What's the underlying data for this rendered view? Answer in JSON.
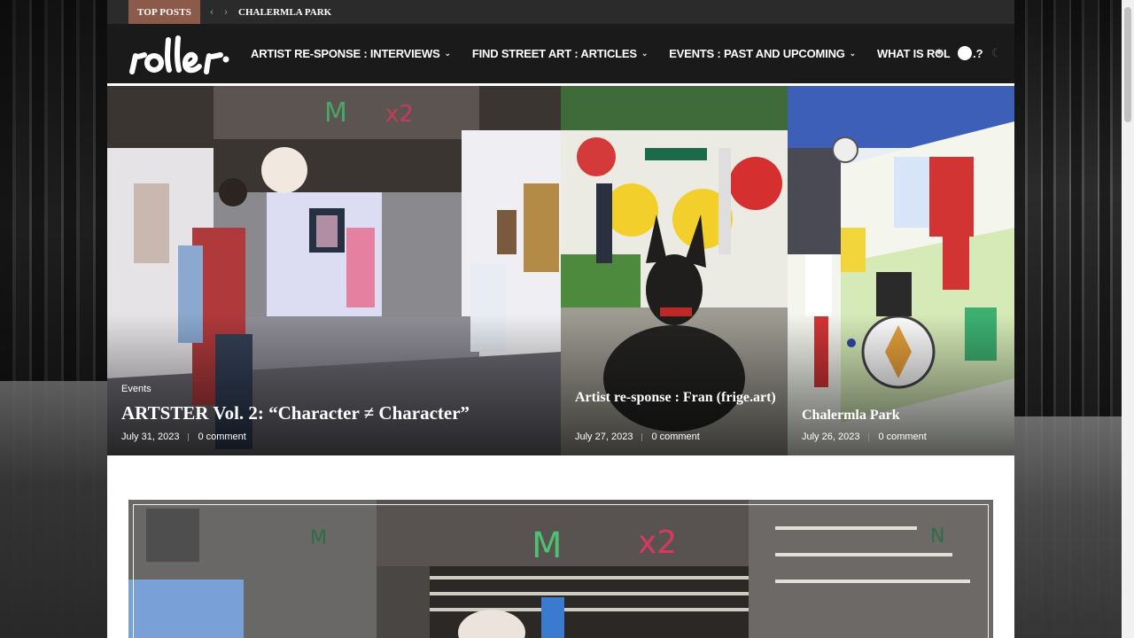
{
  "top_bar": {
    "label": "TOP POSTS",
    "prev_icon": "‹",
    "next_icon": "›",
    "current_post": "CHALERMLA PARK"
  },
  "header": {
    "logo_text": "roller",
    "nav": [
      {
        "label": "ARTIST RE-SPONSE : INTERVIEWS",
        "has_dropdown": true
      },
      {
        "label": "FIND STREET ART : ARTICLES",
        "has_dropdown": true
      },
      {
        "label": "EVENTS : PAST AND UPCOMING",
        "has_dropdown": true
      },
      {
        "label": "WHAT IS ROLLER.?",
        "has_dropdown": false
      }
    ],
    "chevron": "⌄",
    "light_icon": "☀",
    "dark_icon": "☾"
  },
  "featured": [
    {
      "category": "Events",
      "title": "ARTSTER Vol. 2: “Character ≠ Character”",
      "date": "July 31, 2023",
      "comments": "0 comment"
    },
    {
      "category": "",
      "title": "Artist re-sponse : Fran (frige.art)",
      "date": "July 27, 2023",
      "comments": "0 comment"
    },
    {
      "category": "",
      "title": "Chalermla Park",
      "date": "July 26, 2023",
      "comments": "0 comment"
    }
  ],
  "colors": {
    "topbar_bg": "#2b2b2b",
    "top_posts_label_bg": "#8b5a4a",
    "header_bg": "#1a1a1a",
    "content_bg": "#ffffff"
  }
}
